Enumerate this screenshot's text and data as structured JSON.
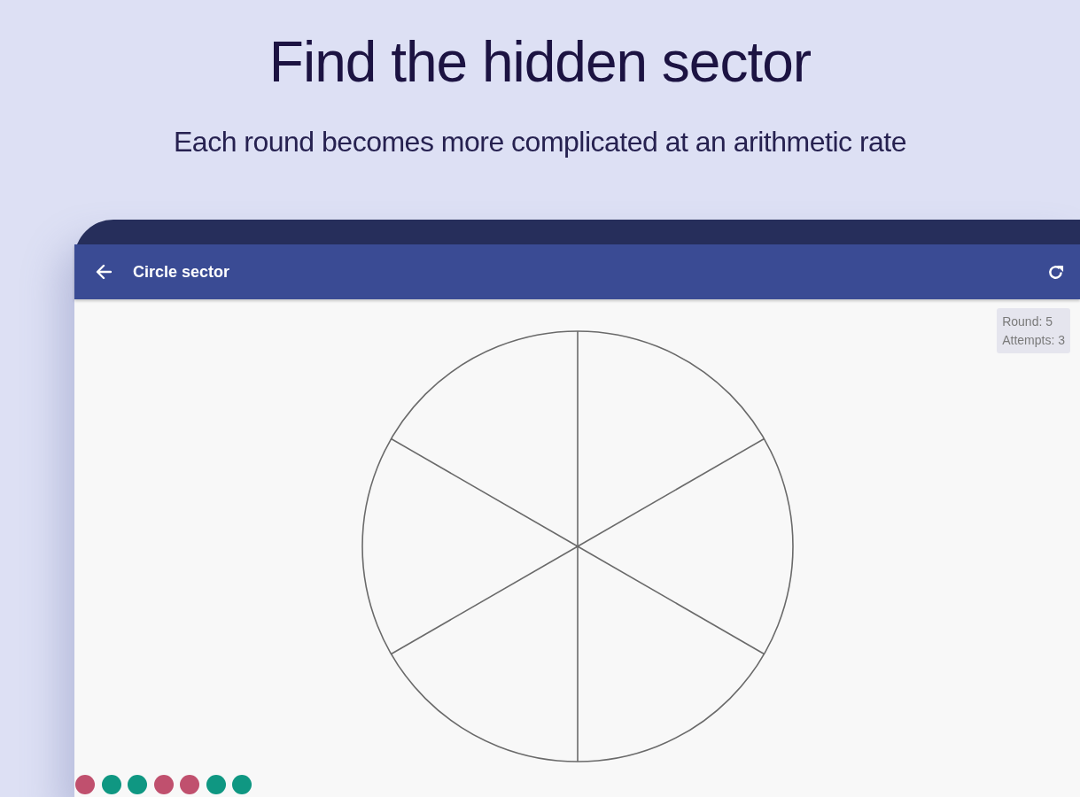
{
  "heading": {
    "title": "Find the hidden sector",
    "subtitle": "Each round becomes more complicated at an arithmetic rate"
  },
  "app_bar": {
    "title": "Circle sector"
  },
  "stats": [
    "Round: 5",
    "Attempts: 3"
  ],
  "history": [
    {
      "color": "#c0506e"
    },
    {
      "color": "#0f9782"
    },
    {
      "color": "#0f9782"
    },
    {
      "color": "#c0506e"
    },
    {
      "color": "#c0506e"
    },
    {
      "color": "#0f9782"
    },
    {
      "color": "#0f9782"
    }
  ]
}
